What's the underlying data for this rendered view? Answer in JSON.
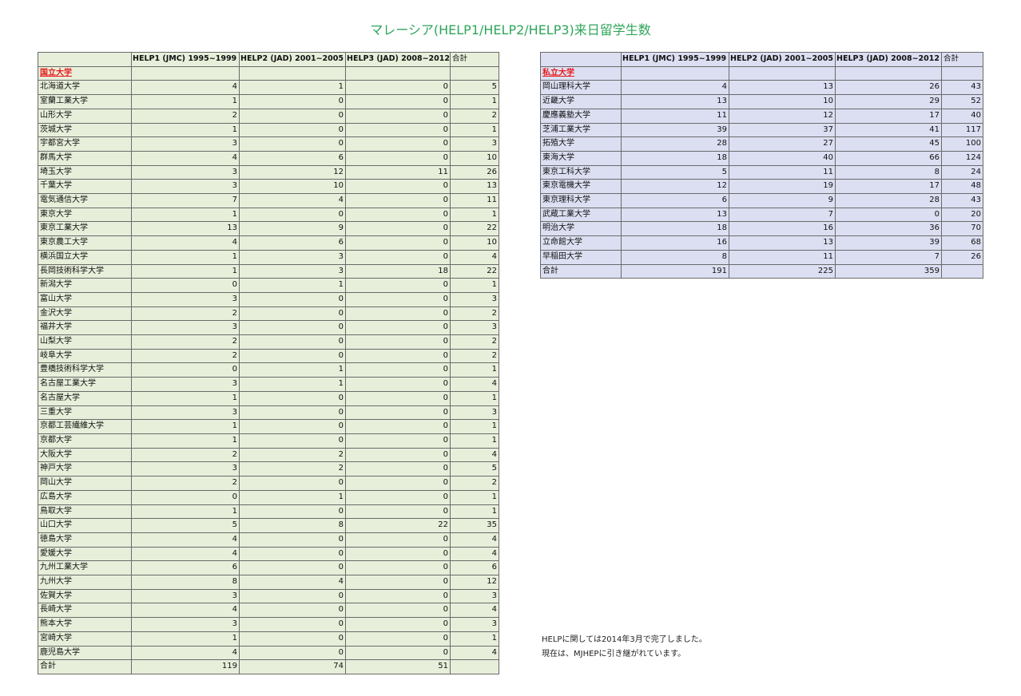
{
  "title": "マレーシア(HELP1/HELP2/HELP3)来日留学生数",
  "columns": [
    "",
    "HELP1 (JMC) 1995~1999",
    "HELP2 (JAD) 2001~2005",
    "HELP3 (JAD) 2008~2012",
    "合計"
  ],
  "national": {
    "section_label": "国立大学",
    "rows": [
      [
        "北海道大学",
        "4",
        "1",
        "0",
        "5"
      ],
      [
        "室蘭工業大学",
        "1",
        "0",
        "0",
        "1"
      ],
      [
        "山形大学",
        "2",
        "0",
        "0",
        "2"
      ],
      [
        "茨城大学",
        "1",
        "0",
        "0",
        "1"
      ],
      [
        "宇都宮大学",
        "3",
        "0",
        "0",
        "3"
      ],
      [
        "群馬大学",
        "4",
        "6",
        "0",
        "10"
      ],
      [
        "埼玉大学",
        "3",
        "12",
        "11",
        "26"
      ],
      [
        "千葉大学",
        "3",
        "10",
        "0",
        "13"
      ],
      [
        "電気通信大学",
        "7",
        "4",
        "0",
        "11"
      ],
      [
        "東京大学",
        "1",
        "0",
        "0",
        "1"
      ],
      [
        "東京工業大学",
        "13",
        "9",
        "0",
        "22"
      ],
      [
        "東京農工大学",
        "4",
        "6",
        "0",
        "10"
      ],
      [
        "横浜国立大学",
        "1",
        "3",
        "0",
        "4"
      ],
      [
        "長岡技術科学大学",
        "1",
        "3",
        "18",
        "22"
      ],
      [
        "新潟大学",
        "0",
        "1",
        "0",
        "1"
      ],
      [
        "富山大学",
        "3",
        "0",
        "0",
        "3"
      ],
      [
        "金沢大学",
        "2",
        "0",
        "0",
        "2"
      ],
      [
        "福井大学",
        "3",
        "0",
        "0",
        "3"
      ],
      [
        "山梨大学",
        "2",
        "0",
        "0",
        "2"
      ],
      [
        "岐阜大学",
        "2",
        "0",
        "0",
        "2"
      ],
      [
        "豊橋技術科学大学",
        "0",
        "1",
        "0",
        "1"
      ],
      [
        "名古屋工業大学",
        "3",
        "1",
        "0",
        "4"
      ],
      [
        "名古屋大学",
        "1",
        "0",
        "0",
        "1"
      ],
      [
        "三重大学",
        "3",
        "0",
        "0",
        "3"
      ],
      [
        "京都工芸繊維大学",
        "1",
        "0",
        "0",
        "1"
      ],
      [
        "京都大学",
        "1",
        "0",
        "0",
        "1"
      ],
      [
        "大阪大学",
        "2",
        "2",
        "0",
        "4"
      ],
      [
        "神戸大学",
        "3",
        "2",
        "0",
        "5"
      ],
      [
        "岡山大学",
        "2",
        "0",
        "0",
        "2"
      ],
      [
        "広島大学",
        "0",
        "1",
        "0",
        "1"
      ],
      [
        "鳥取大学",
        "1",
        "0",
        "0",
        "1"
      ],
      [
        "山口大学",
        "5",
        "8",
        "22",
        "35"
      ],
      [
        "徳島大学",
        "4",
        "0",
        "0",
        "4"
      ],
      [
        "愛媛大学",
        "4",
        "0",
        "0",
        "4"
      ],
      [
        "九州工業大学",
        "6",
        "0",
        "0",
        "6"
      ],
      [
        "九州大学",
        "8",
        "4",
        "0",
        "12"
      ],
      [
        "佐賀大学",
        "3",
        "0",
        "0",
        "3"
      ],
      [
        "長崎大学",
        "4",
        "0",
        "0",
        "4"
      ],
      [
        "熊本大学",
        "3",
        "0",
        "0",
        "3"
      ],
      [
        "宮崎大学",
        "1",
        "0",
        "0",
        "1"
      ],
      [
        "鹿児島大学",
        "4",
        "0",
        "0",
        "4"
      ]
    ],
    "total": [
      "合計",
      "119",
      "74",
      "51",
      ""
    ]
  },
  "private": {
    "section_label": "私立大学",
    "rows": [
      [
        "岡山理科大学",
        "4",
        "13",
        "26",
        "43"
      ],
      [
        "近畿大学",
        "13",
        "10",
        "29",
        "52"
      ],
      [
        "慶應義塾大学",
        "11",
        "12",
        "17",
        "40"
      ],
      [
        "芝浦工業大学",
        "39",
        "37",
        "41",
        "117"
      ],
      [
        "拓殖大学",
        "28",
        "27",
        "45",
        "100"
      ],
      [
        "東海大学",
        "18",
        "40",
        "66",
        "124"
      ],
      [
        "東京工科大学",
        "5",
        "11",
        "8",
        "24"
      ],
      [
        "東京電機大学",
        "12",
        "19",
        "17",
        "48"
      ],
      [
        "東京理科大学",
        "6",
        "9",
        "28",
        "43"
      ],
      [
        "武蔵工業大学",
        "13",
        "7",
        "0",
        "20"
      ],
      [
        "明治大学",
        "18",
        "16",
        "36",
        "70"
      ],
      [
        "立命館大学",
        "16",
        "13",
        "39",
        "68"
      ],
      [
        "早稲田大学",
        "8",
        "11",
        "7",
        "26"
      ]
    ],
    "total": [
      "合計",
      "191",
      "225",
      "359",
      ""
    ]
  },
  "notes": [
    "HELPに関しては2014年3月で完了しました。",
    "現在は、MJHEPに引き継がれています。"
  ]
}
